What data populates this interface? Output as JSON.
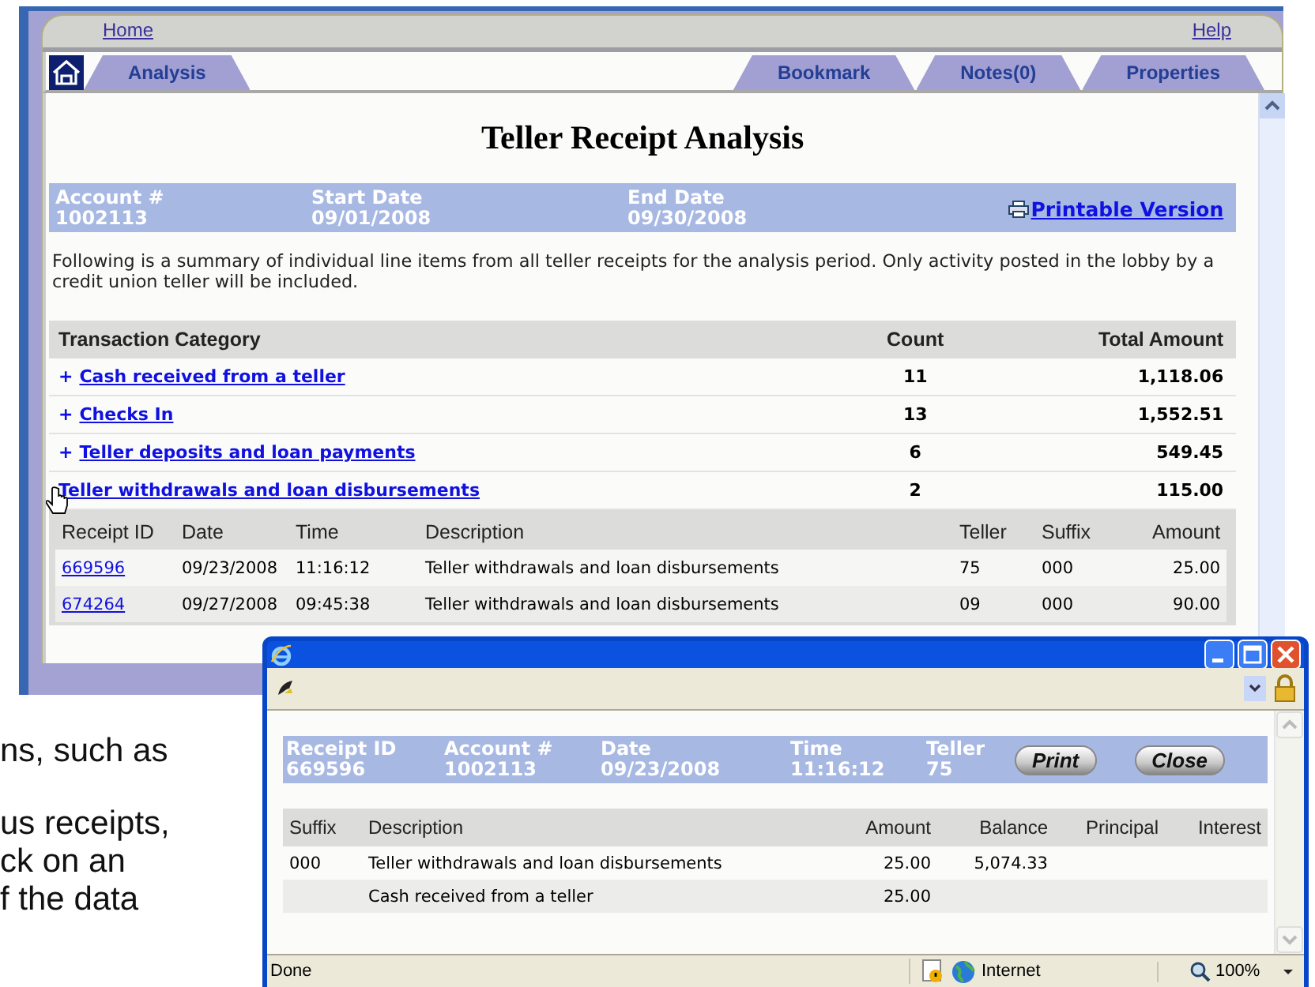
{
  "main_window": {
    "top_links": [
      {
        "label": "Home"
      },
      {
        "label": "Help"
      }
    ],
    "left_tabs": [
      {
        "label": "Analysis"
      }
    ],
    "right_tabs": [
      {
        "label": "Bookmark"
      },
      {
        "label": "Notes(0)"
      },
      {
        "label": "Properties"
      }
    ],
    "title": "Teller Receipt Analysis",
    "summary_fields": [
      {
        "label": "Account #",
        "value": "1002113"
      },
      {
        "label": "Start Date",
        "value": "09/01/2008"
      },
      {
        "label": "End Date",
        "value": "09/30/2008"
      }
    ],
    "printable_link": "Printable Version",
    "description": "Following is a summary of individual line items from all teller receipts for the analysis period. Only activity posted in the lobby by a credit union teller will be included.",
    "table": {
      "columns": [
        "Transaction Category",
        "Count",
        "Total Amount"
      ],
      "rows": [
        {
          "toggle": "+",
          "category": "Cash received from a teller",
          "count": "11",
          "total": "1,118.06",
          "expanded": false
        },
        {
          "toggle": "+",
          "category": "Checks In",
          "count": "13",
          "total": "1,552.51",
          "expanded": false
        },
        {
          "toggle": "+",
          "category": "Teller deposits and loan payments",
          "count": "6",
          "total": "549.45",
          "expanded": false
        },
        {
          "category": "Teller withdrawals and loan disbursements",
          "count": "2",
          "total": "115.00",
          "expanded": true,
          "details": {
            "columns": [
              "Receipt ID",
              "Date",
              "Time",
              "Description",
              "Teller",
              "Suffix",
              "Amount"
            ],
            "rows": [
              [
                "669596",
                "09/23/2008",
                "11:16:12",
                "Teller withdrawals and loan disbursements",
                "75",
                "000",
                "25.00"
              ],
              [
                "674264",
                "09/27/2008",
                "09:45:38",
                "Teller withdrawals and loan disbursements",
                "09",
                "000",
                "90.00"
              ]
            ]
          }
        }
      ]
    }
  },
  "background_text": [
    "ns, such as",
    "us receipts,",
    "ck on an",
    "f the data"
  ],
  "popup": {
    "header_fields": [
      {
        "label": "Receipt ID",
        "value": "669596"
      },
      {
        "label": "Account #",
        "value": "1002113"
      },
      {
        "label": "Date",
        "value": "09/23/2008"
      },
      {
        "label": "Time",
        "value": "11:16:12"
      },
      {
        "label": "Teller",
        "value": "75"
      }
    ],
    "buttons": [
      "Print",
      "Close"
    ],
    "table": {
      "columns": [
        "Suffix",
        "Description",
        "Amount",
        "Balance",
        "Principal",
        "Interest"
      ],
      "rows": [
        {
          "suffix": "000",
          "description": "Teller withdrawals and loan disbursements",
          "amount": "25.00",
          "balance": "5,074.33"
        },
        {
          "description": "Cash received from a teller",
          "amount": "25.00"
        }
      ]
    },
    "status_bar": {
      "status": "Done",
      "zone": "Internet",
      "zoom": "100%"
    }
  }
}
